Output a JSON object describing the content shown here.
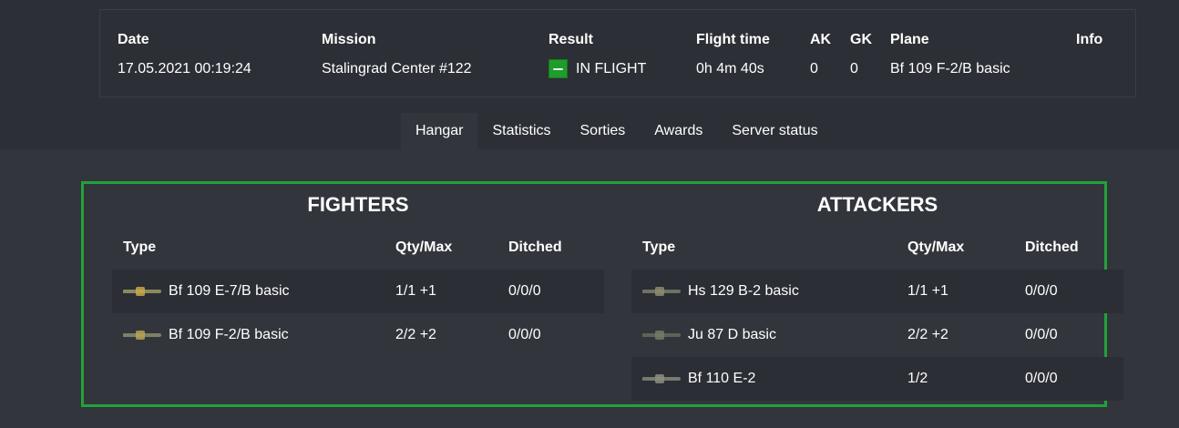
{
  "sortie": {
    "headers": {
      "date": "Date",
      "mission": "Mission",
      "result": "Result",
      "flight_time": "Flight time",
      "ak": "AK",
      "gk": "GK",
      "plane": "Plane",
      "info": "Info"
    },
    "values": {
      "date": "17.05.2021 00:19:24",
      "mission": "Stalingrad Center #122",
      "result": "IN FLIGHT",
      "flight_time": "0h 4m 40s",
      "ak": "0",
      "gk": "0",
      "plane": "Bf 109 F-2/B basic"
    },
    "result_color": "#1e9c2c"
  },
  "tabs": [
    "Hangar",
    "Statistics",
    "Sorties",
    "Awards",
    "Server status"
  ],
  "active_tab": "Hangar",
  "hangar": {
    "frame_color": "#21a23a",
    "fighters": {
      "title": "FIGHTERS",
      "columns": [
        "Type",
        "Qty/Max",
        "Ditched"
      ],
      "rows": [
        {
          "type": "Bf 109 E-7/B basic",
          "qty": "1/1 +1",
          "ditched": "0/0/0",
          "icon": "bf109-plane-icon"
        },
        {
          "type": "Bf 109 F-2/B basic",
          "qty": "2/2 +2",
          "ditched": "0/0/0",
          "icon": "bf109-plane-icon"
        }
      ]
    },
    "attackers": {
      "title": "ATTACKERS",
      "columns": [
        "Type",
        "Qty/Max",
        "Ditched"
      ],
      "rows": [
        {
          "type": "Hs 129 B-2 basic",
          "qty": "1/1 +1",
          "ditched": "0/0/0",
          "icon": "hs129-plane-icon"
        },
        {
          "type": "Ju 87 D basic",
          "qty": "2/2 +2",
          "ditched": "0/0/0",
          "icon": "ju87-plane-icon"
        },
        {
          "type": "Bf 110 E-2",
          "qty": "1/2",
          "ditched": "0/0/0",
          "icon": "bf110-plane-icon"
        }
      ]
    }
  }
}
